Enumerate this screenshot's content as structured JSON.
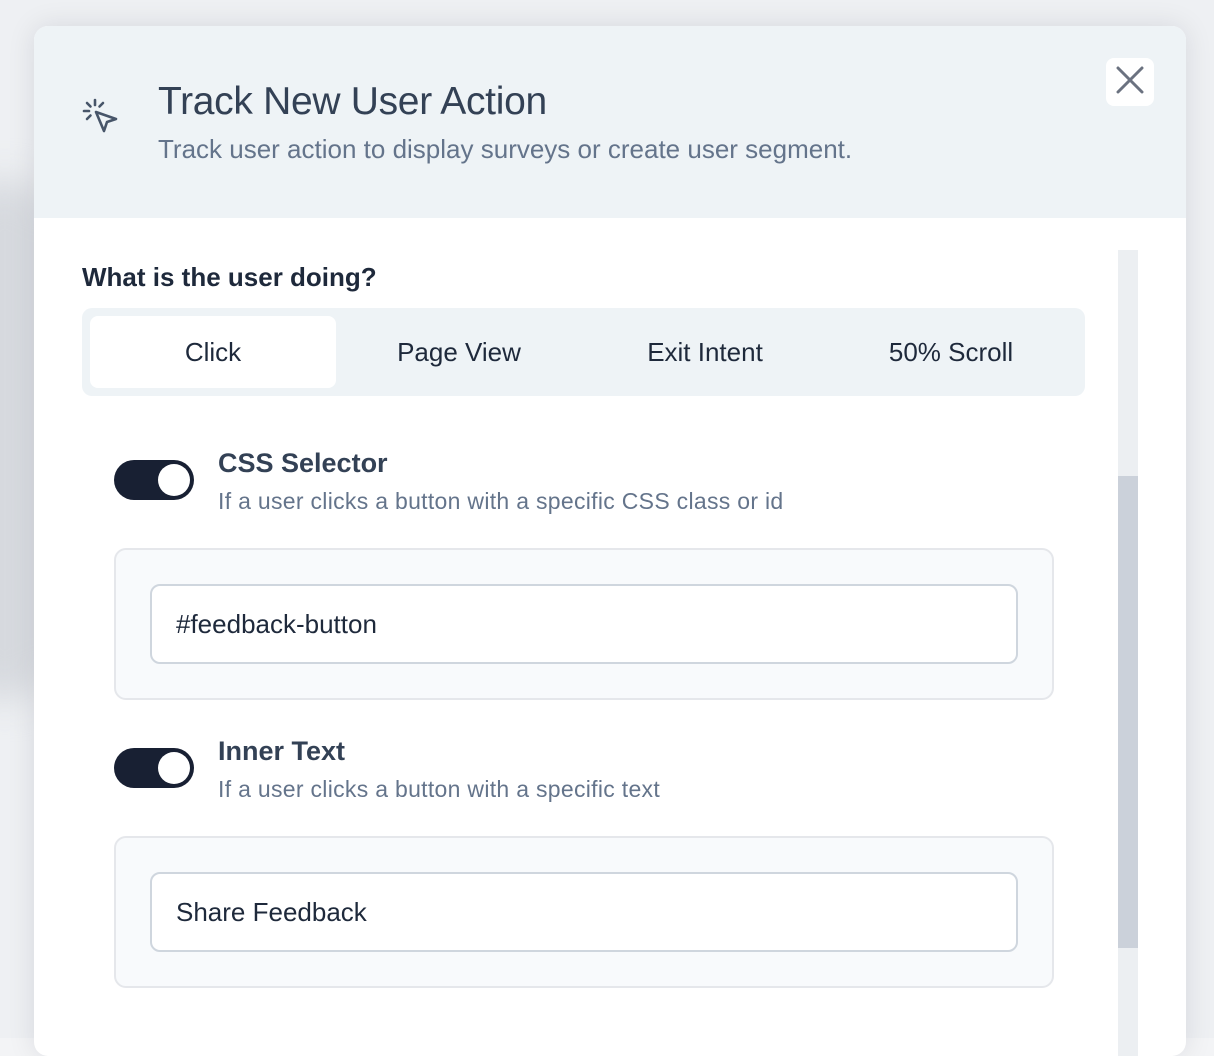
{
  "modal": {
    "title": "Track New User Action",
    "subtitle": "Track user action to display surveys or create user segment.",
    "header_icon": "cursor-click-icon",
    "close_icon": "close-icon"
  },
  "question": "What is the user doing?",
  "tabs": [
    {
      "label": "Click",
      "active": true
    },
    {
      "label": "Page View",
      "active": false
    },
    {
      "label": "Exit Intent",
      "active": false
    },
    {
      "label": "50% Scroll",
      "active": false
    }
  ],
  "options": {
    "css_selector": {
      "title": "CSS Selector",
      "description": "If a user clicks a button with a specific CSS class or id",
      "enabled": true,
      "value": "#feedback-button"
    },
    "inner_text": {
      "title": "Inner Text",
      "description": "If a user clicks a button with a specific text",
      "enabled": true,
      "value": "Share Feedback"
    }
  },
  "colors": {
    "header_bg": "#eef3f6",
    "toggle_on": "#182033",
    "text_dark": "#1e293b",
    "text_muted": "#64748b"
  }
}
